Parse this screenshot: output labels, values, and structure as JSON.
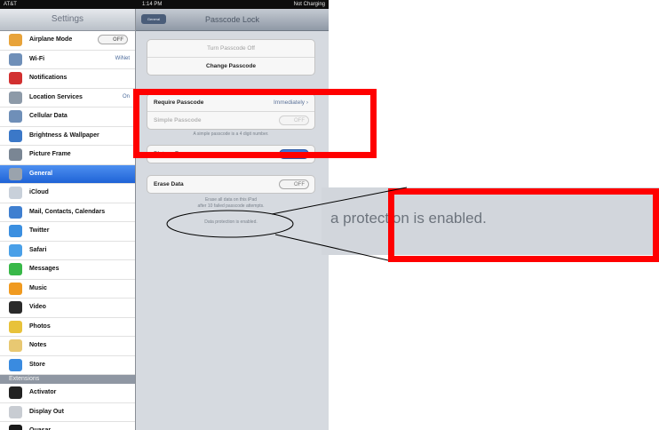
{
  "status_bar": {
    "carrier": "AT&T",
    "time": "1:14 PM",
    "battery": "Not Charging"
  },
  "sidebar": {
    "title": "Settings",
    "items": [
      {
        "label": "Airplane Mode",
        "icon": "airplane-icon",
        "color": "#e8a33a",
        "toggle": "OFF"
      },
      {
        "label": "Wi-Fi",
        "icon": "wifi-icon",
        "color": "#6f8fb8",
        "value": "WiNet"
      },
      {
        "label": "Notifications",
        "icon": "notifications-icon",
        "color": "#d23030"
      },
      {
        "label": "Location Services",
        "icon": "location-icon",
        "color": "#8d9aa8",
        "value": "On"
      },
      {
        "label": "Cellular Data",
        "icon": "cellular-icon",
        "color": "#6f8fb8"
      },
      {
        "label": "Brightness & Wallpaper",
        "icon": "brightness-icon",
        "color": "#3b78c8"
      },
      {
        "label": "Picture Frame",
        "icon": "picture-frame-icon",
        "color": "#7a8694"
      },
      {
        "label": "General",
        "icon": "gear-icon",
        "color": "#9aa3ad",
        "selected": true
      },
      {
        "label": "iCloud",
        "icon": "cloud-icon",
        "color": "#c8d0da"
      },
      {
        "label": "Mail, Contacts, Calendars",
        "icon": "mail-icon",
        "color": "#3f7fd0"
      },
      {
        "label": "Twitter",
        "icon": "twitter-icon",
        "color": "#3b8fe0"
      },
      {
        "label": "Safari",
        "icon": "safari-icon",
        "color": "#4aa0e8"
      },
      {
        "label": "Messages",
        "icon": "messages-icon",
        "color": "#38b848"
      },
      {
        "label": "Music",
        "icon": "music-icon",
        "color": "#f09a20"
      },
      {
        "label": "Video",
        "icon": "video-icon",
        "color": "#2a2a2a"
      },
      {
        "label": "Photos",
        "icon": "photos-icon",
        "color": "#e8c23a"
      },
      {
        "label": "Notes",
        "icon": "notes-icon",
        "color": "#e8c872"
      },
      {
        "label": "Store",
        "icon": "store-icon",
        "color": "#3a8be0"
      }
    ],
    "extensions_header": "Extensions",
    "extensions": [
      {
        "label": "Activator",
        "icon": "activator-icon",
        "color": "#222222"
      },
      {
        "label": "Display Out",
        "icon": "display-out-icon",
        "color": "#c8ccd2"
      },
      {
        "label": "Quasar",
        "icon": "quasar-icon",
        "color": "#1a1a1a"
      }
    ]
  },
  "detail": {
    "back_label": "General",
    "title": "Passcode Lock",
    "turn_off": "Turn Passcode Off",
    "change": "Change Passcode",
    "require_label": "Require Passcode",
    "require_value": "Immediately",
    "simple_label": "Simple Passcode",
    "simple_toggle": "OFF",
    "simple_note": "A simple passcode is a 4 digit number.",
    "picture_frame_label": "Picture Frame",
    "erase_label": "Erase Data",
    "erase_toggle": "OFF",
    "erase_note_1": "Erase all data on this iPad",
    "erase_note_2": "after 10 failed passcode attempts.",
    "protection_note": "Data protection is enabled."
  },
  "zoom_callout": {
    "text": "a protection is enabled."
  },
  "colors": {
    "annotation": "#ff0000",
    "selected": "#2a6fdb"
  }
}
